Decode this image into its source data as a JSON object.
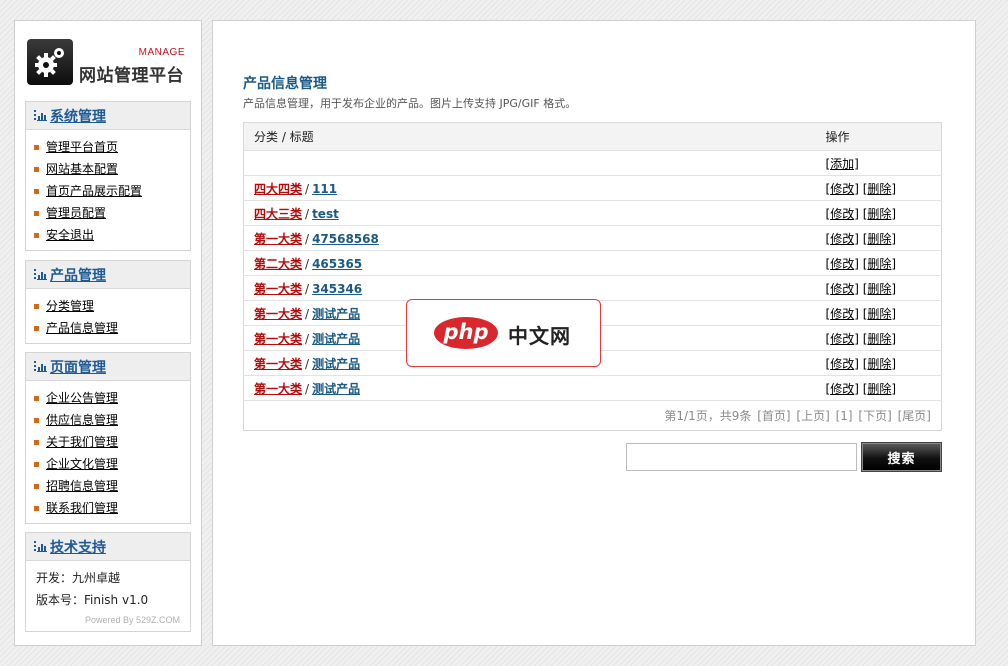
{
  "logo": {
    "tag": "MANAGE",
    "title": "网站管理平台"
  },
  "sidebar": {
    "system": {
      "title": "系统管理",
      "items": [
        "管理平台首页",
        "网站基本配置",
        "首页产品展示配置",
        "管理员配置",
        "安全退出"
      ]
    },
    "product": {
      "title": "产品管理",
      "items": [
        "分类管理",
        "产品信息管理"
      ]
    },
    "pages": {
      "title": "页面管理",
      "items": [
        "企业公告管理",
        "供应信息管理",
        "关于我们管理",
        "企业文化管理",
        "招聘信息管理",
        "联系我们管理"
      ]
    },
    "tech": {
      "title": "技术支持",
      "developer": "开发：九州卓越",
      "version": "版本号：Finish v1.0",
      "powered": "Powered By 529Z.COM"
    }
  },
  "main": {
    "title": "产品信息管理",
    "description": "产品信息管理，用于发布企业的产品。图片上传支持 JPG/GIF 格式。",
    "table": {
      "header": {
        "category_title": "分类 / 标题",
        "actions": "操作"
      },
      "add_label": "[添加]",
      "separator": "/",
      "edit_label": "修改",
      "delete_label": "删除",
      "rows": [
        {
          "category": "四大四类",
          "title": "111"
        },
        {
          "category": "四大三类",
          "title": "test"
        },
        {
          "category": "第一大类",
          "title": "47568568"
        },
        {
          "category": "第二大类",
          "title": "465365"
        },
        {
          "category": "第一大类",
          "title": "345346"
        },
        {
          "category": "第一大类",
          "title": "测试产品"
        },
        {
          "category": "第一大类",
          "title": "测试产品"
        },
        {
          "category": "第一大类",
          "title": "测试产品"
        },
        {
          "category": "第一大类",
          "title": "测试产品"
        }
      ],
      "pager": {
        "summary": "第1/1页，共9条",
        "first": "[首页]",
        "prev": "[上页]",
        "current": "[1]",
        "next": "[下页]",
        "last": "[尾页]"
      }
    },
    "search": {
      "value": "",
      "button_label": "搜索"
    }
  },
  "watermark": {
    "brand": "php",
    "text": "中文网"
  }
}
